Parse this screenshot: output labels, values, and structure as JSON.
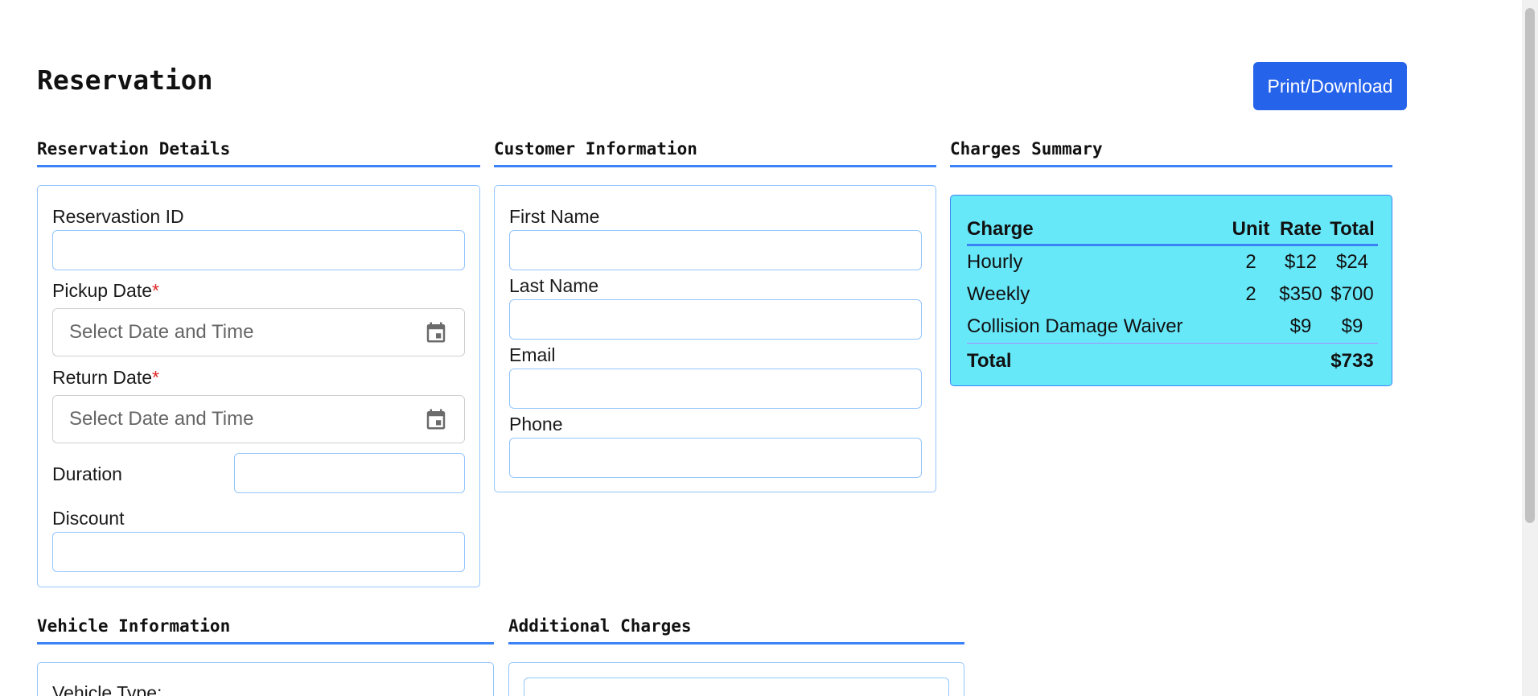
{
  "page": {
    "title": "Reservation",
    "print_button": "Print/Download"
  },
  "reservation_details": {
    "heading": "Reservation Details",
    "id_label": "Reservastion ID",
    "id_value": "",
    "pickup_label": "Pickup Date",
    "pickup_placeholder": "Select Date and Time",
    "return_label": "Return Date",
    "return_placeholder": "Select Date and Time",
    "required_mark": "*",
    "duration_label": "Duration",
    "duration_value": "",
    "discount_label": "Discount",
    "discount_value": ""
  },
  "customer_information": {
    "heading": "Customer Information",
    "first_name_label": "First Name",
    "last_name_label": "Last Name",
    "email_label": "Email",
    "phone_label": "Phone"
  },
  "charges_summary": {
    "heading": "Charges Summary",
    "columns": [
      "Charge",
      "Unit",
      "Rate",
      "Total"
    ],
    "rows": [
      {
        "charge": "Hourly",
        "unit": "2",
        "rate": "$12",
        "total": "$24"
      },
      {
        "charge": "Weekly",
        "unit": "2",
        "rate": "$350",
        "total": "$700"
      },
      {
        "charge": "Collision Damage Waiver",
        "unit": "",
        "rate": "$9",
        "total": "$9"
      }
    ],
    "total_label": "Total",
    "total_value": "$733"
  },
  "vehicle_information": {
    "heading": "Vehicle Information",
    "vehicle_type_label": "Vehicle Type:"
  },
  "additional_charges": {
    "heading": "Additional Charges"
  },
  "colors": {
    "accent": "#3b82f6",
    "button": "#2563eb",
    "charges_bg": "#67e8f9",
    "required": "#dc2626"
  },
  "icons": {
    "calendar": "calendar-icon"
  }
}
